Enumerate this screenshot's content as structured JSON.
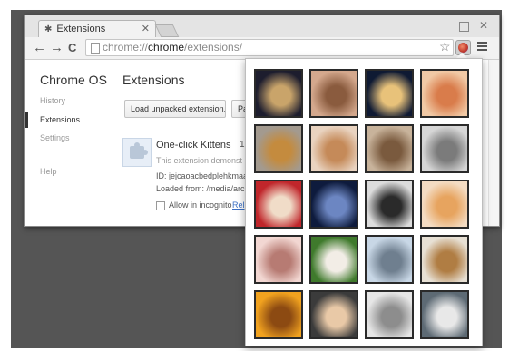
{
  "browser": {
    "tab_title": "Extensions",
    "tab_icon": "puzzle-icon",
    "url_scheme": "chrome://",
    "url_host": "chrome",
    "url_path": "/extensions/",
    "nav_back": "←",
    "nav_forward": "→",
    "nav_reload": "C",
    "star": "☆",
    "window_close": "✕",
    "tab_close": "✕"
  },
  "sidebar": {
    "title": "Chrome OS",
    "items": [
      {
        "label": "History",
        "active": false
      },
      {
        "label": "Extensions",
        "active": true
      },
      {
        "label": "Settings",
        "active": false
      },
      {
        "label": "Help",
        "active": false
      }
    ]
  },
  "main": {
    "title": "Extensions",
    "buttons": [
      "Load unpacked extension...",
      "Pa"
    ],
    "extension": {
      "name": "One-click Kittens",
      "version": "1.",
      "description": "This extension demonst",
      "id_line": "ID: jejcaoacbedplehkmaap",
      "loaded_line": "Loaded from: /media/archi",
      "incognito_label": "Allow in incognito",
      "reload_link": "Rel"
    }
  },
  "popup": {
    "thumbnails": [
      {
        "name": "kitten-thumb-1",
        "colors": [
          "#1d1d2e",
          "#c9a46a"
        ]
      },
      {
        "name": "kitten-thumb-2",
        "colors": [
          "#d4a88d",
          "#8a5b3e"
        ]
      },
      {
        "name": "kitten-thumb-3",
        "colors": [
          "#0f1a33",
          "#e8c27a"
        ]
      },
      {
        "name": "kitten-thumb-4",
        "colors": [
          "#f1c9a5",
          "#d97c4b"
        ]
      },
      {
        "name": "kitten-thumb-5",
        "colors": [
          "#a39a8f",
          "#c48b3e"
        ]
      },
      {
        "name": "kitten-thumb-6",
        "colors": [
          "#e9d3c0",
          "#c58a59"
        ]
      },
      {
        "name": "kitten-thumb-7",
        "colors": [
          "#c8b39b",
          "#7a5a3e"
        ]
      },
      {
        "name": "kitten-thumb-8",
        "colors": [
          "#d6d6d6",
          "#7b7b7b"
        ]
      },
      {
        "name": "kitten-thumb-9",
        "colors": [
          "#c0262b",
          "#f0dcc8"
        ]
      },
      {
        "name": "kitten-thumb-10",
        "colors": [
          "#0e1b3d",
          "#6c86c2"
        ]
      },
      {
        "name": "kitten-thumb-11",
        "colors": [
          "#dcdcdc",
          "#2a2a2a"
        ]
      },
      {
        "name": "kitten-thumb-12",
        "colors": [
          "#f4dcc3",
          "#e7a45f"
        ]
      },
      {
        "name": "kitten-thumb-13",
        "colors": [
          "#f2d7d2",
          "#b77b73"
        ]
      },
      {
        "name": "kitten-thumb-14",
        "colors": [
          "#3f7a2c",
          "#f2ede6"
        ]
      },
      {
        "name": "kitten-thumb-15",
        "colors": [
          "#c8d7e6",
          "#6f7f8f"
        ]
      },
      {
        "name": "kitten-thumb-16",
        "colors": [
          "#e7e0d4",
          "#b07d43"
        ]
      },
      {
        "name": "kitten-thumb-17",
        "colors": [
          "#f1a21f",
          "#8c4a12"
        ]
      },
      {
        "name": "kitten-thumb-18",
        "colors": [
          "#3b3b3b",
          "#e9c9a7"
        ]
      },
      {
        "name": "kitten-thumb-19",
        "colors": [
          "#e6e6e6",
          "#8d8d8d"
        ]
      },
      {
        "name": "kitten-thumb-20",
        "colors": [
          "#5d6a74",
          "#e8e8e8"
        ]
      }
    ]
  }
}
